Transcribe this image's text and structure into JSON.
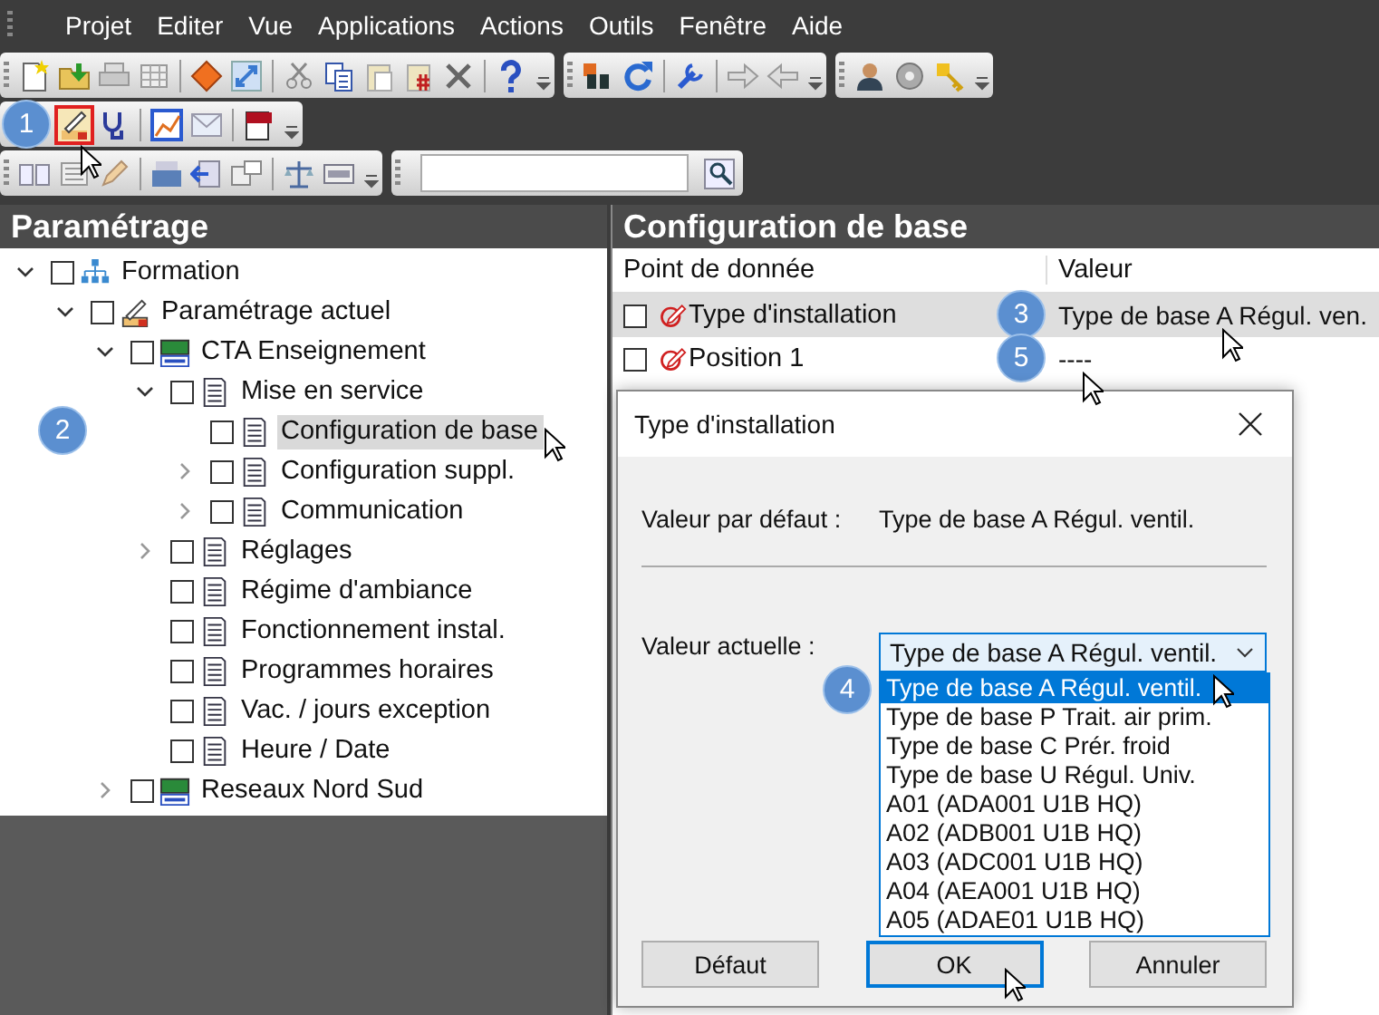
{
  "menu": [
    "Projet",
    "Editer",
    "Vue",
    "Applications",
    "Actions",
    "Outils",
    "Fenêtre",
    "Aide"
  ],
  "toolbars": [
    {
      "kind": "standard",
      "highlighted": false
    },
    {
      "kind": "tools",
      "highlighted": true,
      "callout": "1"
    },
    {
      "kind": "view",
      "highlighted": false
    }
  ],
  "tree": {
    "title": "Paramétrage",
    "items": [
      {
        "label": "Formation",
        "kind": "network",
        "checked": false,
        "selected": false,
        "expanded": true,
        "children": [
          {
            "label": "Paramétrage actuel",
            "kind": "tool",
            "checked": false,
            "selected": false,
            "expanded": true,
            "children": [
              {
                "label": "CTA Enseignement",
                "kind": "controller",
                "checked": false,
                "selected": false,
                "expanded": true,
                "children": [
                  {
                    "label": "Mise en service",
                    "kind": "page",
                    "checked": false,
                    "selected": false,
                    "expanded": true,
                    "children": [
                      {
                        "label": "Configuration de base",
                        "kind": "page",
                        "checked": false,
                        "selected": true,
                        "callout": "2"
                      },
                      {
                        "label": "Configuration suppl.",
                        "kind": "page",
                        "checked": false,
                        "selected": false,
                        "expanded": false
                      },
                      {
                        "label": "Communication",
                        "kind": "page",
                        "checked": false,
                        "selected": false,
                        "expanded": false
                      }
                    ]
                  },
                  {
                    "label": "Réglages",
                    "kind": "page",
                    "checked": false,
                    "selected": false,
                    "expanded": false
                  },
                  {
                    "label": "Régime d'ambiance",
                    "kind": "page",
                    "checked": false,
                    "selected": false
                  },
                  {
                    "label": "Fonctionnement instal.",
                    "kind": "page",
                    "checked": false,
                    "selected": false
                  },
                  {
                    "label": "Programmes horaires",
                    "kind": "page",
                    "checked": false,
                    "selected": false
                  },
                  {
                    "label": "Vac. / jours exception",
                    "kind": "page",
                    "checked": false,
                    "selected": false
                  },
                  {
                    "label": "Heure / Date",
                    "kind": "page",
                    "checked": false,
                    "selected": false
                  }
                ]
              },
              {
                "label": "Reseaux Nord Sud",
                "kind": "controller",
                "checked": false,
                "selected": false,
                "expanded": false
              }
            ]
          }
        ]
      }
    ]
  },
  "details": {
    "title": "Configuration de base",
    "columns": [
      "Point de donnée",
      "Valeur"
    ],
    "rows": [
      {
        "label": "Type d'installation",
        "value": "Type de base A Régul. ven.",
        "checked": false,
        "selected": true,
        "callout": "3"
      },
      {
        "label": "Position 1",
        "value": "----",
        "checked": false,
        "selected": false,
        "callout": "5"
      }
    ]
  },
  "dialog": {
    "title": "Type d'installation",
    "default_label": "Valeur par défaut :",
    "default_value": "Type de base A Régul. ventil.",
    "current_label": "Valeur actuelle :",
    "current_value": "Type de base A Régul. ventil.",
    "expanded": true,
    "options": [
      {
        "label": "Type de base A Régul. ventil.",
        "selected": true,
        "callout": "4"
      },
      {
        "label": "Type de base P Trait. air prim.",
        "selected": false
      },
      {
        "label": "Type de base C Prér. froid",
        "selected": false
      },
      {
        "label": "Type de base U Régul. Univ.",
        "selected": false
      },
      {
        "label": "A01 (ADA001 U1B HQ)",
        "selected": false
      },
      {
        "label": "A02 (ADB001 U1B HQ)",
        "selected": false
      },
      {
        "label": "A03 (ADC001 U1B HQ)",
        "selected": false
      },
      {
        "label": "A04 (AEA001 U1B HQ)",
        "selected": false
      },
      {
        "label": "A05 (ADAE01 U1B HQ)",
        "selected": false
      }
    ],
    "buttons": [
      {
        "label": "Défaut",
        "focused": false
      },
      {
        "label": "OK",
        "focused": true
      },
      {
        "label": "Annuler",
        "focused": false
      }
    ]
  }
}
